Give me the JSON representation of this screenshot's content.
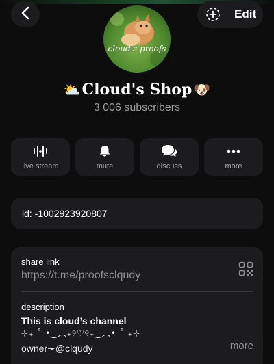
{
  "header": {
    "edit_label": "Edit"
  },
  "channel": {
    "name": "Cloud's Shop",
    "name_emoji_left": "⛅",
    "name_emoji_right": "🐶",
    "subscribers": "3 006 subscribers",
    "avatar_text": "cloud's proofs"
  },
  "actions": [
    {
      "label": "live stream",
      "icon": "live-stream-icon"
    },
    {
      "label": "mute",
      "icon": "bell-icon"
    },
    {
      "label": "discuss",
      "icon": "chat-bubbles-icon"
    },
    {
      "label": "more",
      "icon": "ellipsis-icon"
    }
  ],
  "info": {
    "id_text": "id: -1002923920807",
    "share_link_label": "share link",
    "share_link_value": "https://t.me/proofsclqudy",
    "description_label": "description",
    "description_line1": "This is cloud’s channel",
    "description_line2": "⊹₊ ˚ •‿︵₊୨♡୧₊‿︵• ˚ ₊⊹",
    "description_line3": "owner➛@clqudy",
    "more_label": "more"
  },
  "colors": {
    "background": "#0d0d0d",
    "card": "#1c1c1e",
    "muted_text": "#8e8e93"
  }
}
